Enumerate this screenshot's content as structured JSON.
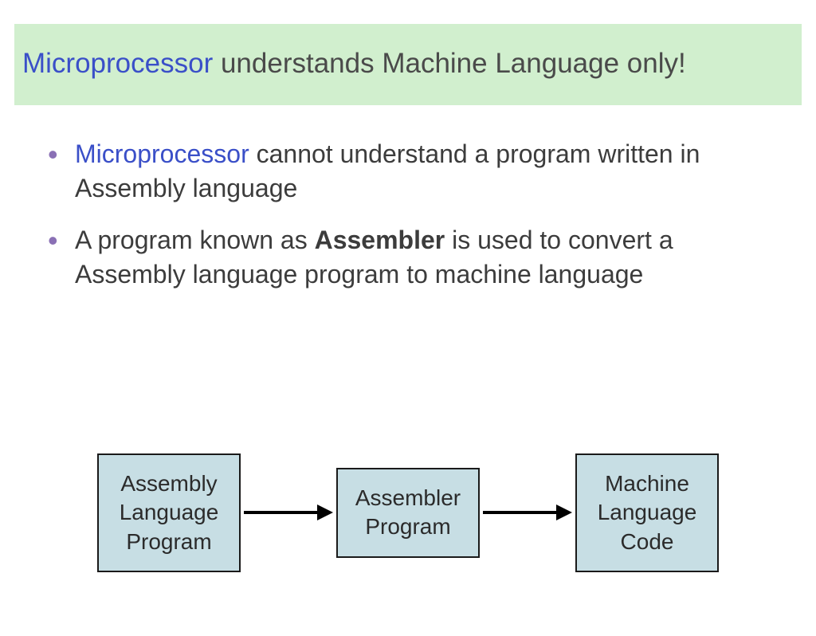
{
  "title": {
    "highlight": "Microprocessor",
    "rest": " understands Machine Language only!"
  },
  "bullets": [
    {
      "hl": "Microprocessor",
      "text": " cannot understand a program written in Assembly language"
    },
    {
      "pre": "A program known as ",
      "bold": "Assembler",
      "post": " is used to convert a Assembly language program to machine language"
    }
  ],
  "diagram": {
    "box1": {
      "l1": "Assembly",
      "l2": "Language",
      "l3": "Program"
    },
    "box2": {
      "l1": "Assembler",
      "l2": "Program"
    },
    "box3": {
      "l1": "Machine",
      "l2": "Language",
      "l3": "Code"
    }
  }
}
